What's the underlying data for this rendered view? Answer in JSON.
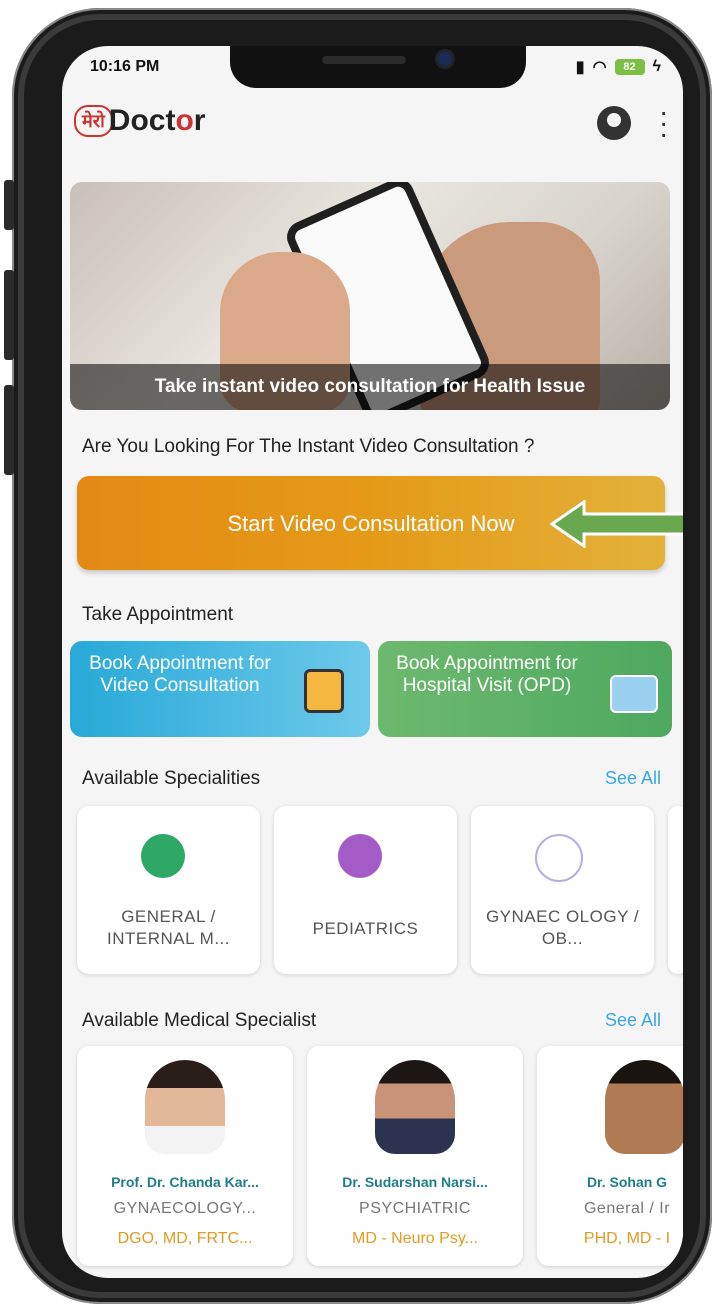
{
  "status": {
    "time": "10:16 PM",
    "battery": "82"
  },
  "appbar": {
    "logo_badge": "मेरो",
    "logo_d": "D",
    "logo_text1": "oct",
    "logo_o": "o",
    "logo_text2": "r"
  },
  "banner": {
    "caption": "Take instant video consultation for Health Issue"
  },
  "consult": {
    "question": "Are You Looking For The Instant Video Consultation ?",
    "cta_label": "Start Video Consultation Now"
  },
  "appointment": {
    "heading": "Take Appointment",
    "video_label": "Book Appointment for Video Consultation",
    "opd_label": "Book Appointment for Hospital Visit (OPD)"
  },
  "specialities": {
    "heading": "Available Specialities",
    "see_all": "See All",
    "items": [
      {
        "label": "GENERAL / INTERNAL M...",
        "color": "#2fa866"
      },
      {
        "label": "PEDIATRICS",
        "color": "#a35bc6"
      },
      {
        "label": "GYNAEC OLOGY / OB...",
        "color": "#b6aee0"
      }
    ]
  },
  "specialists": {
    "heading": "Available Medical Specialist",
    "see_all": "See All",
    "items": [
      {
        "name": "Prof. Dr. Chanda Kar...",
        "speciality": "GYNAECOLOGY...",
        "degree": "DGO, MD, FRTC..."
      },
      {
        "name": "Dr. Sudarshan Narsi...",
        "speciality": "PSYCHIATRIC",
        "degree": "MD - Neuro Psy..."
      },
      {
        "name": "Dr. Sohan G",
        "speciality": "General / Ir",
        "degree": "PHD, MD - I"
      }
    ]
  },
  "colors": {
    "accent_orange": "#e59a17",
    "link_blue": "#39a8e0",
    "name_teal": "#1e7e88",
    "arrow_green": "#6aa84f"
  }
}
